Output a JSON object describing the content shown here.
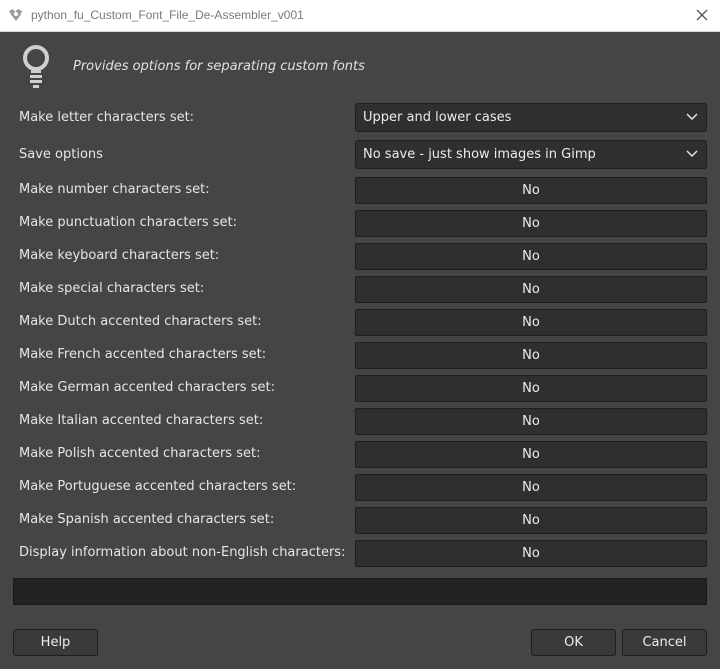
{
  "window": {
    "title": "python_fu_Custom_Font_File_De-Assembler_v001"
  },
  "header": {
    "description": "Provides options for separating custom fonts"
  },
  "options": {
    "letter_set": {
      "label": "Make letter  characters set:",
      "value": "Upper and lower cases"
    },
    "save": {
      "label": "Save options",
      "value": "No save - just show images in Gimp"
    },
    "toggles": [
      {
        "label": "Make number characters set:",
        "value": "No"
      },
      {
        "label": "Make punctuation characters set:",
        "value": "No"
      },
      {
        "label": "Make keyboard characters set:",
        "value": "No"
      },
      {
        "label": "Make special characters set:",
        "value": "No"
      },
      {
        "label": "Make Dutch accented characters set:",
        "value": "No"
      },
      {
        "label": "Make French accented characters set:",
        "value": "No"
      },
      {
        "label": "Make German accented characters set:",
        "value": "No"
      },
      {
        "label": "Make Italian accented characters set:",
        "value": "No"
      },
      {
        "label": "Make Polish accented characters set:",
        "value": "No"
      },
      {
        "label": "Make Portuguese accented characters set:",
        "value": "No"
      },
      {
        "label": "Make Spanish accented characters set:",
        "value": "No"
      },
      {
        "label": "Display information about non-English characters:",
        "value": "No"
      }
    ]
  },
  "buttons": {
    "help": "Help",
    "ok": "OK",
    "cancel": "Cancel"
  },
  "icons": {
    "app": "gimp-icon",
    "header": "lightbulb-icon",
    "close": "close-icon",
    "dropdown": "chevron-down-icon"
  }
}
